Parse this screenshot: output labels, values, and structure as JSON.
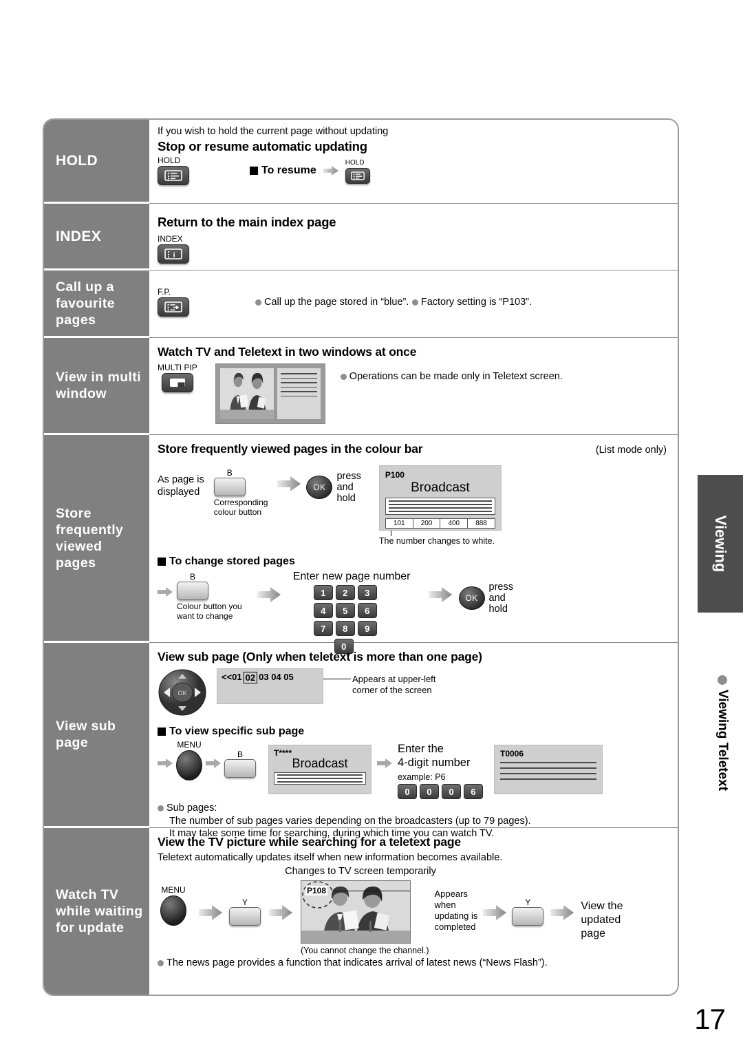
{
  "page_number": "17",
  "side_tab": {
    "label": "Viewing",
    "section_label": "Viewing Teletext"
  },
  "sidebar": {
    "items": [
      {
        "label": "HOLD"
      },
      {
        "label": "INDEX"
      },
      {
        "label": "Call up a favourite pages"
      },
      {
        "label": "View in multi window"
      },
      {
        "label": "Store frequently viewed pages"
      },
      {
        "label": "View sub page"
      },
      {
        "label": "Watch TV while waiting for update"
      }
    ]
  },
  "sections": {
    "hold": {
      "intro": "If you wish to hold the current page without updating",
      "heading": "Stop or resume automatic updating",
      "button_label": "HOLD",
      "resume_label": "To resume",
      "resume_button_label": "HOLD"
    },
    "index": {
      "heading": "Return to the main index page",
      "button_label": "INDEX"
    },
    "favourite": {
      "button_label": "F.P.",
      "bullet1": "Call up the page stored in “blue”.",
      "bullet2": "Factory setting is “P103”."
    },
    "multi_window": {
      "heading": "Watch TV and Teletext in two windows at once",
      "button_label": "MULTI PIP",
      "bullet1": "Operations can be made only in Teletext screen."
    },
    "store": {
      "heading": "Store frequently viewed pages in the colour bar",
      "heading_note": "(List mode only)",
      "step1_line1": "As page is",
      "step1_line2": "displayed",
      "colour_key_label": "B",
      "colour_key_caption_line1": "Corresponding",
      "colour_key_caption_line2": "colour button",
      "ok_label": "OK",
      "ok_caption_line1": "press",
      "ok_caption_line2": "and",
      "ok_caption_line3": "hold",
      "screen": {
        "page_label": "P100",
        "title": "Broadcast",
        "colour_bar": [
          "101",
          "200",
          "400",
          "888"
        ]
      },
      "screen_note": "The number changes to white.",
      "change_heading": "To change stored pages",
      "change_key_label": "B",
      "change_key_caption_line1": "Colour button you",
      "change_key_caption_line2": "want to change",
      "enter_label": "Enter new page number",
      "keypad": [
        "1",
        "2",
        "3",
        "4",
        "5",
        "6",
        "7",
        "8",
        "9",
        "0"
      ],
      "change_ok_label": "OK",
      "change_ok_caption_line1": "press",
      "change_ok_caption_line2": "and",
      "change_ok_caption_line3": "hold"
    },
    "sub_page": {
      "heading": "View sub page (Only when teletext is more than one page)",
      "dpad_ok_label": "OK",
      "indicator": "<<01 02 03 04 05",
      "indicator_prefix": "<<01",
      "indicator_boxed": "02",
      "indicator_suffix": "03 04 05",
      "callout_line1": "Appears at upper-left",
      "callout_line2": "corner of the screen",
      "specific_heading": "To view specific sub page",
      "menu_label": "MENU",
      "colour_key_label": "B",
      "screen1": {
        "page_label": "T****",
        "title": "Broadcast"
      },
      "enter_line1": "Enter the",
      "enter_line2": "4-digit number",
      "example_label": "example: P6",
      "example_digits": [
        "0",
        "0",
        "0",
        "6"
      ],
      "screen2": {
        "page_label": "T0006"
      },
      "bullet_title": "Sub pages:",
      "bullet_line1": "The number of sub pages varies depending on the broadcasters (up to 79 pages).",
      "bullet_line2": "It may take some time for searching, during which time you can watch TV."
    },
    "waiting": {
      "heading": "View the TV picture while searching for a teletext page",
      "intro": "Teletext automatically updates itself when new information becomes available.",
      "caption_top": "Changes to TV screen temporarily",
      "menu_label": "MENU",
      "key1_label": "Y",
      "screen_page_label": "P108",
      "callout_line1": "Appears",
      "callout_line2": "when",
      "callout_line3": "updating is",
      "callout_line4": "completed",
      "key2_label": "Y",
      "result_line1": "View the",
      "result_line2": "updated",
      "result_line3": "page",
      "screen_note": "(You cannot change the channel.)",
      "bullet1": "The news page provides a function that indicates arrival of latest news (“News Flash”)."
    }
  },
  "colors": {
    "sidebar_bg": "#808080",
    "side_tab_bg": "#4d4d4d",
    "screen_bg": "#cfcfcf"
  }
}
